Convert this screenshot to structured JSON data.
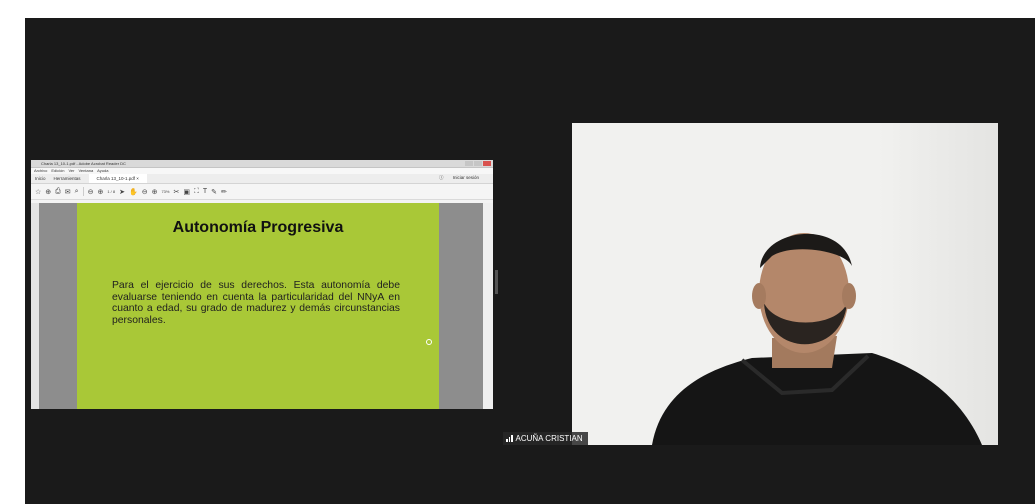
{
  "reader": {
    "window_title": "Charla 13_10-1.pdf - Adobe Acrobat Reader DC",
    "menu": [
      "Archivo",
      "Edición",
      "Ver",
      "Ventana",
      "Ayuda"
    ],
    "tabs": [
      "Inicio",
      "Herramientas"
    ],
    "doc_tab": "Charla 13_10-1.pdf  ×",
    "sign_in": "Iniciar sesión",
    "page_indicator": "1 / 8",
    "zoom": "73%"
  },
  "slide": {
    "title": "Autonomía Progresiva",
    "body": "Para el ejercicio de sus derechos. Esta autonomía debe evaluarse teniendo en cuenta la particularidad del NNyA en cuanto a edad, su grado de madurez y demás circunstancias personales."
  },
  "participant": {
    "name": "ACUÑA CRISTIAN"
  }
}
